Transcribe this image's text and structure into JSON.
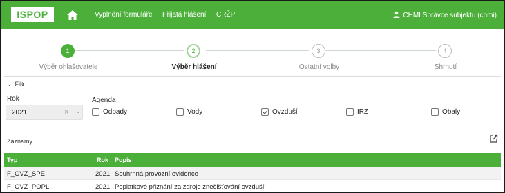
{
  "header": {
    "logo": "ISPOP",
    "nav": [
      "Vyplnění formuláře",
      "Přijatá hlášení",
      "CRŽP"
    ],
    "user": "CHMI Správce subjektu (chmi)"
  },
  "stepper": {
    "steps": [
      {
        "number": "1",
        "label": "Výběr ohlašovatele",
        "state": "done"
      },
      {
        "number": "2",
        "label": "Výběr hlášení",
        "state": "active"
      },
      {
        "number": "3",
        "label": "Ostatní volby",
        "state": "todo"
      },
      {
        "number": "4",
        "label": "Shrnutí",
        "state": "todo"
      }
    ]
  },
  "filter": {
    "toggle_label": "Filtr",
    "year_label": "Rok",
    "year_value": "2021",
    "agenda_label": "Agenda",
    "agendas": [
      {
        "label": "Odpady",
        "checked": false
      },
      {
        "label": "Vody",
        "checked": false
      },
      {
        "label": "Ovzduší",
        "checked": true
      },
      {
        "label": "IRZ",
        "checked": false
      },
      {
        "label": "Obaly",
        "checked": false
      }
    ]
  },
  "records": {
    "title": "Záznamy",
    "columns": [
      "Typ",
      "Rok",
      "Popis"
    ],
    "rows": [
      {
        "typ": "F_OVZ_SPE",
        "rok": "2021",
        "popis": "Souhrnná provozní evidence"
      },
      {
        "typ": "F_OVZ_POPL",
        "rok": "2021",
        "popis": "Poplatkové přiznání za zdroje znečišťování ovzduší"
      }
    ]
  },
  "colors": {
    "brand_green": "#4caf3a",
    "row_alt": "#f2f2f2"
  }
}
